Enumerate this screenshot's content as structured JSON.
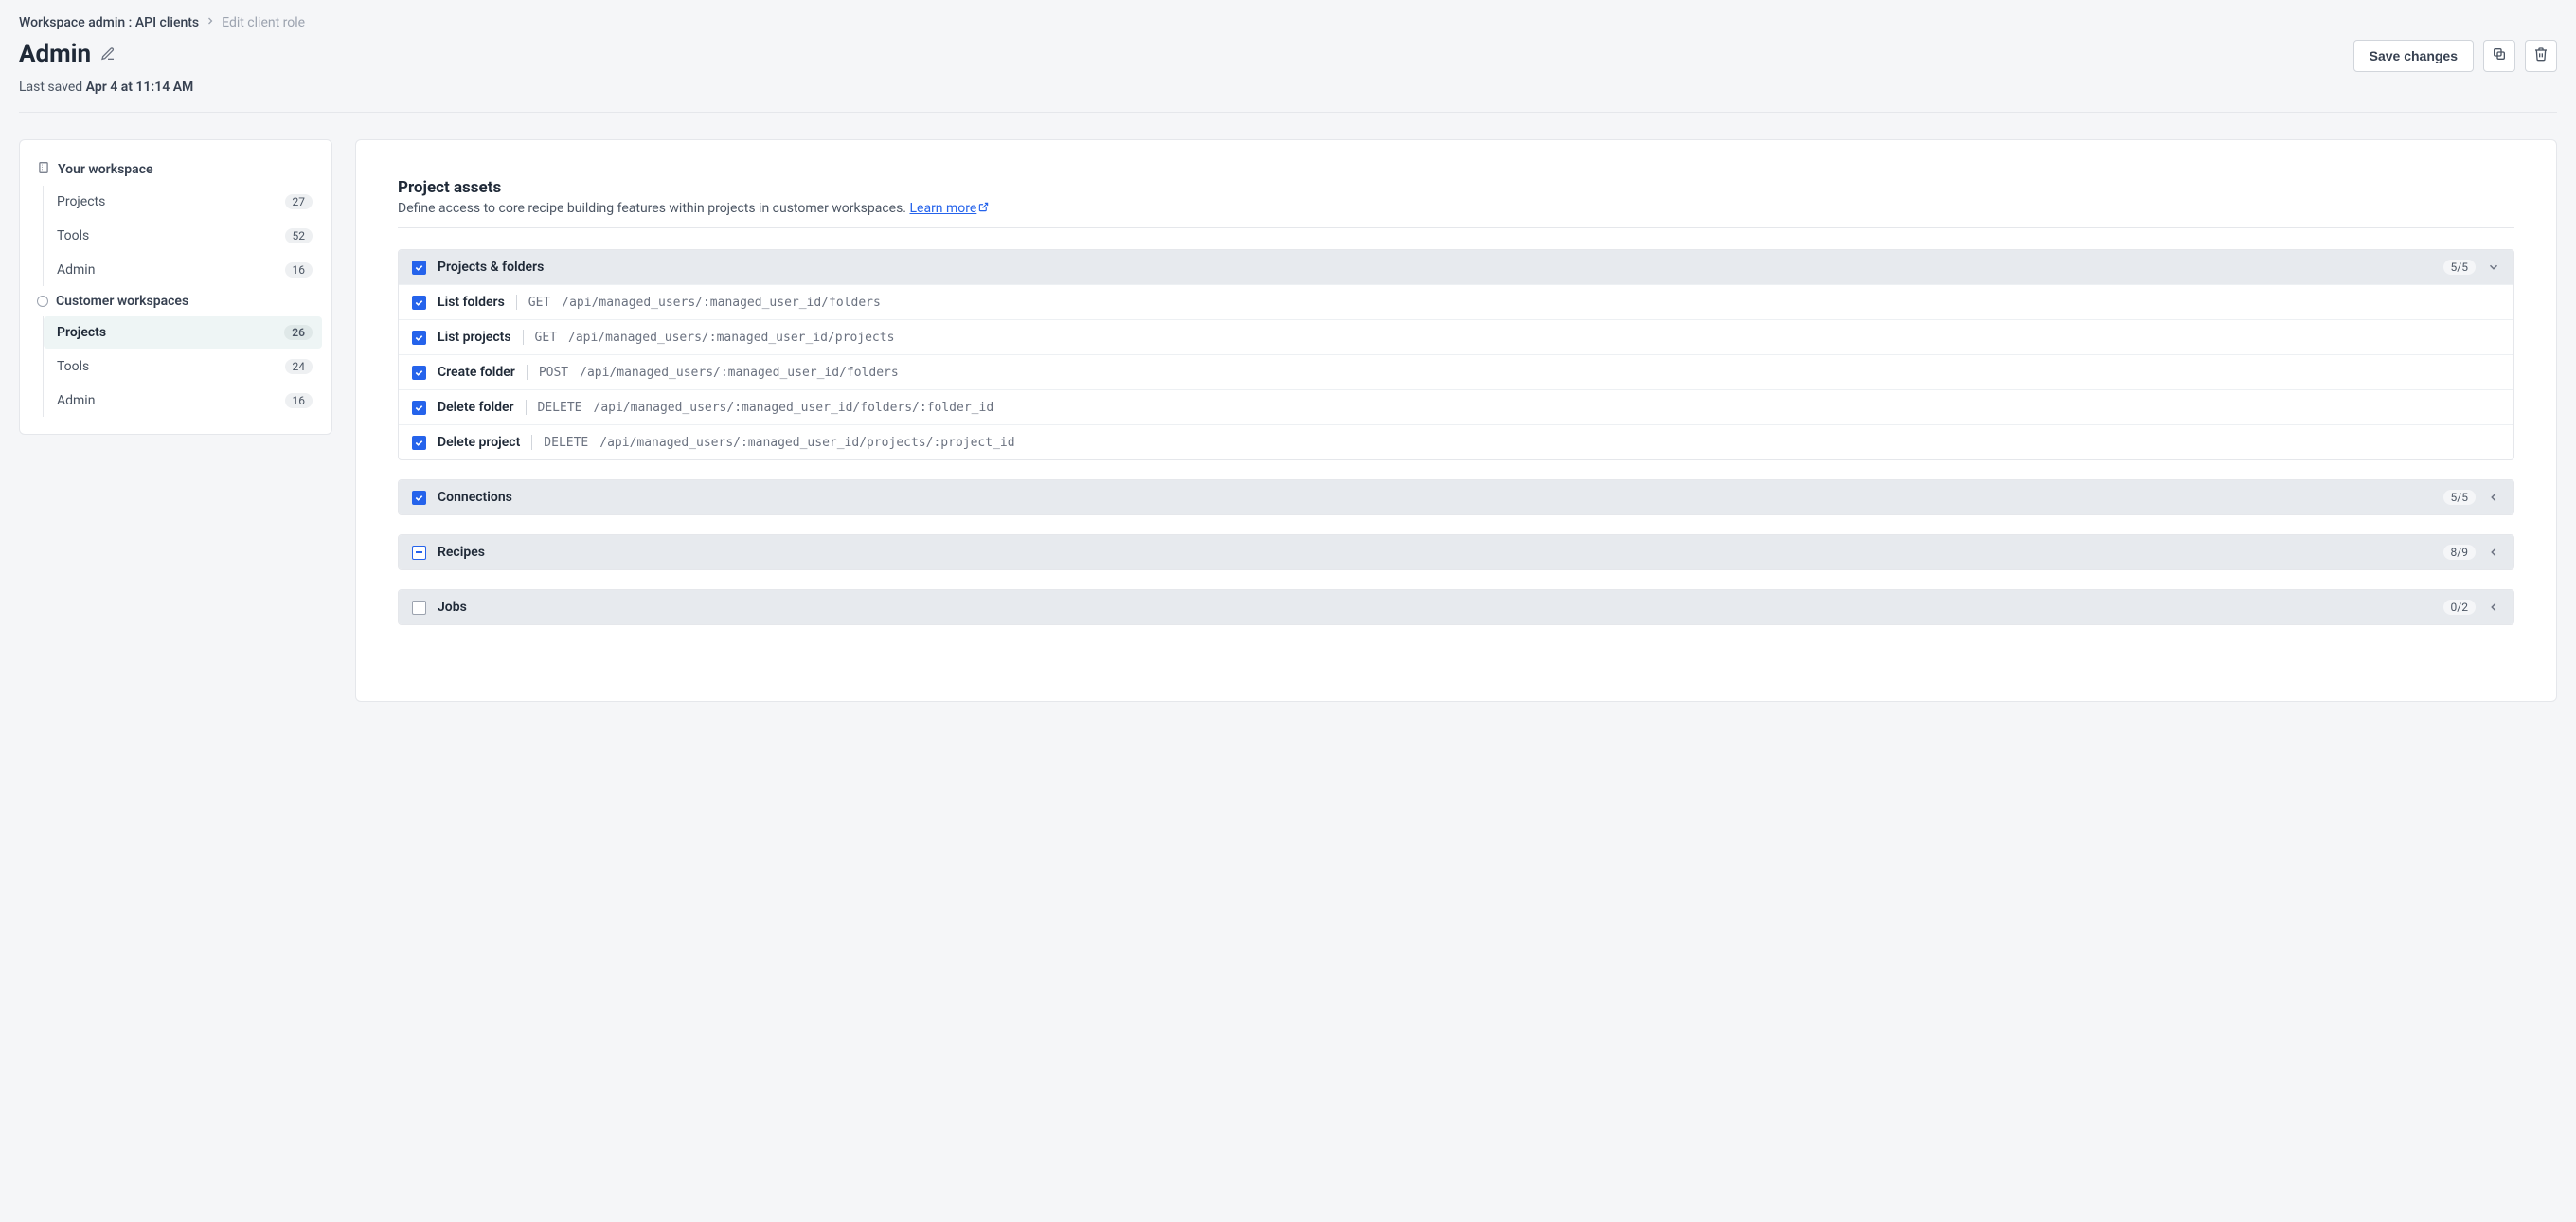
{
  "breadcrumb": {
    "parent": "Workspace admin : API clients",
    "current": "Edit client role"
  },
  "header": {
    "title": "Admin",
    "save_label": "Save changes"
  },
  "last_saved": {
    "prefix": "Last saved ",
    "timestamp": "Apr 4 at 11:14 AM"
  },
  "sidebar": {
    "sections": [
      {
        "title": "Your workspace",
        "icon": "building",
        "items": [
          {
            "label": "Projects",
            "count": "27",
            "active": false
          },
          {
            "label": "Tools",
            "count": "52",
            "active": false
          },
          {
            "label": "Admin",
            "count": "16",
            "active": false
          }
        ]
      },
      {
        "title": "Customer workspaces",
        "icon": "radio-empty",
        "items": [
          {
            "label": "Projects",
            "count": "26",
            "active": true
          },
          {
            "label": "Tools",
            "count": "24",
            "active": false
          },
          {
            "label": "Admin",
            "count": "16",
            "active": false
          }
        ]
      }
    ]
  },
  "main": {
    "section_title": "Project assets",
    "section_desc_prefix": "Define access to core recipe building features within projects in customer workspaces. ",
    "learn_more": "Learn more",
    "groups": [
      {
        "title": "Projects & folders",
        "state": "checked",
        "expanded": true,
        "count": "5/5",
        "rows": [
          {
            "name": "List folders",
            "method": "GET",
            "path": "/api/managed_users/:managed_user_id/folders"
          },
          {
            "name": "List projects",
            "method": "GET",
            "path": "/api/managed_users/:managed_user_id/projects"
          },
          {
            "name": "Create folder",
            "method": "POST",
            "path": "/api/managed_users/:managed_user_id/folders"
          },
          {
            "name": "Delete folder",
            "method": "DELETE",
            "path": "/api/managed_users/:managed_user_id/folders/:folder_id"
          },
          {
            "name": "Delete project",
            "method": "DELETE",
            "path": "/api/managed_users/:managed_user_id/projects/:project_id"
          }
        ]
      },
      {
        "title": "Connections",
        "state": "checked",
        "expanded": false,
        "count": "5/5",
        "rows": []
      },
      {
        "title": "Recipes",
        "state": "indeterminate",
        "expanded": false,
        "count": "8/9",
        "rows": []
      },
      {
        "title": "Jobs",
        "state": "empty",
        "expanded": false,
        "count": "0/2",
        "rows": []
      }
    ]
  }
}
